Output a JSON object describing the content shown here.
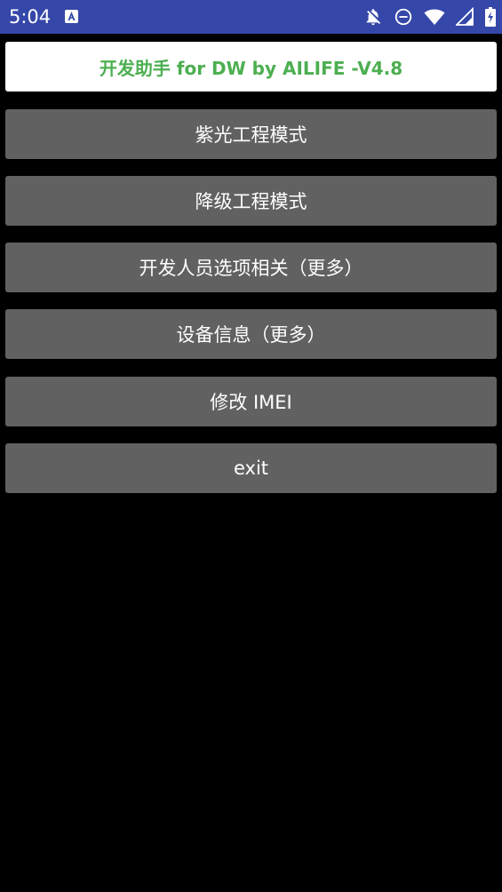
{
  "status_bar": {
    "time": "5:04",
    "icons": [
      "app-notification-icon",
      "notifications-off-icon",
      "do-not-disturb-icon",
      "wifi-icon",
      "cellular-signal-icon",
      "battery-charging-icon"
    ],
    "background_color": "#3547a8"
  },
  "header": {
    "title": "开发助手 for DW by AILIFE -V4.8",
    "title_color": "#4caf50"
  },
  "menu": {
    "button_color": "#616161",
    "items": [
      {
        "label": "紫光工程模式"
      },
      {
        "label": "降级工程模式"
      },
      {
        "label": "开发人员选项相关（更多）"
      },
      {
        "label": "设备信息（更多）"
      },
      {
        "label": "修改 IMEI"
      },
      {
        "label": "exit"
      }
    ]
  }
}
